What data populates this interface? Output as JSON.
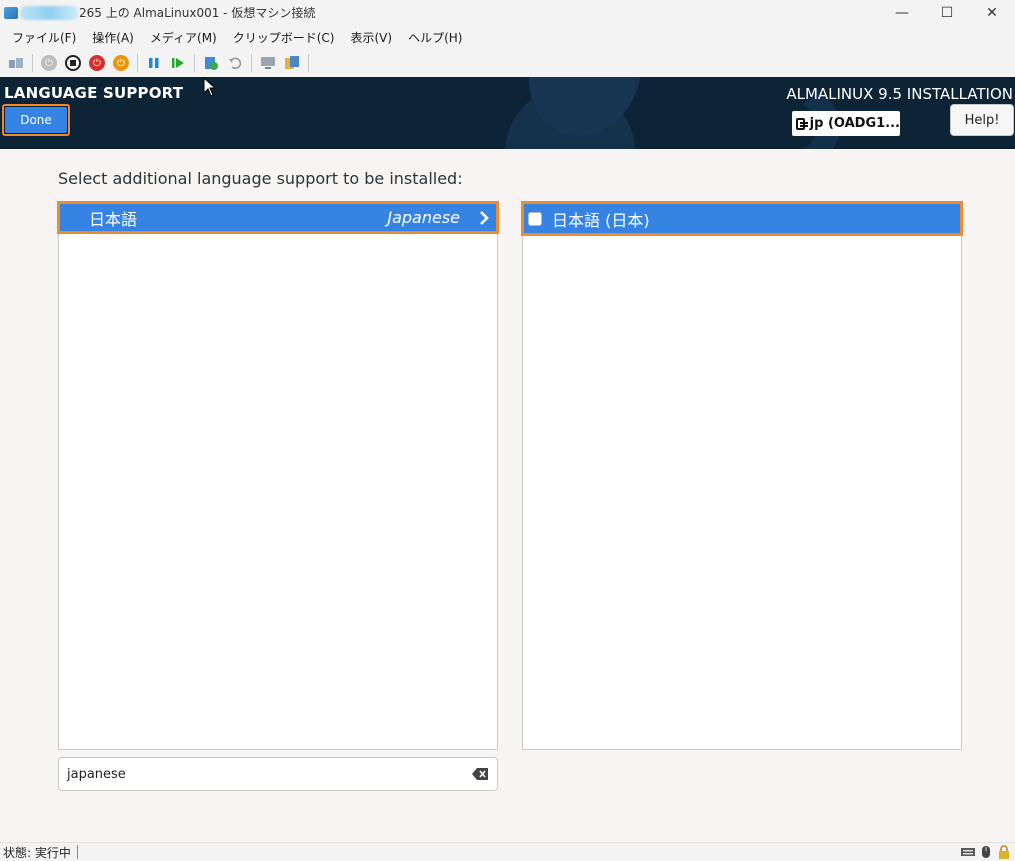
{
  "window": {
    "title": "265 上の AlmaLinux001 - 仮想マシン接続",
    "minimize_glyph": "—",
    "maximize_glyph": "☐",
    "close_glyph": "✕"
  },
  "menubar": {
    "items": [
      "ファイル(F)",
      "操作(A)",
      "メディア(M)",
      "クリップボード(C)",
      "表示(V)",
      "ヘルプ(H)"
    ]
  },
  "toolbar": {
    "icons": [
      "ctrl-alt-del-icon",
      "start-icon",
      "turn-off-icon",
      "shutdown-icon",
      "save-icon",
      "pause-icon",
      "resume-icon",
      "checkpoint-icon",
      "revert-icon",
      "enhanced-session-icon",
      "share-icon"
    ]
  },
  "header": {
    "spoke_title": "LANGUAGE SUPPORT",
    "done_label": "Done",
    "install_title": "ALMALINUX 9.5 INSTALLATION",
    "keyboard_layout": "jp (OADG1...",
    "help_label": "Help!"
  },
  "main": {
    "prompt": "Select additional language support to be installed:",
    "languages": [
      {
        "native": "日本語",
        "english": "Japanese",
        "selected": true
      }
    ],
    "locales": [
      {
        "label": "日本語 (日本)",
        "checked": false,
        "selected": true
      }
    ],
    "search": {
      "value": "japanese"
    }
  },
  "statusbar": {
    "status_text": "状態: 実行中"
  },
  "colors": {
    "accent": "#3584e4",
    "highlight_border": "#ef8a2f",
    "header_bg": "#0d2436"
  }
}
